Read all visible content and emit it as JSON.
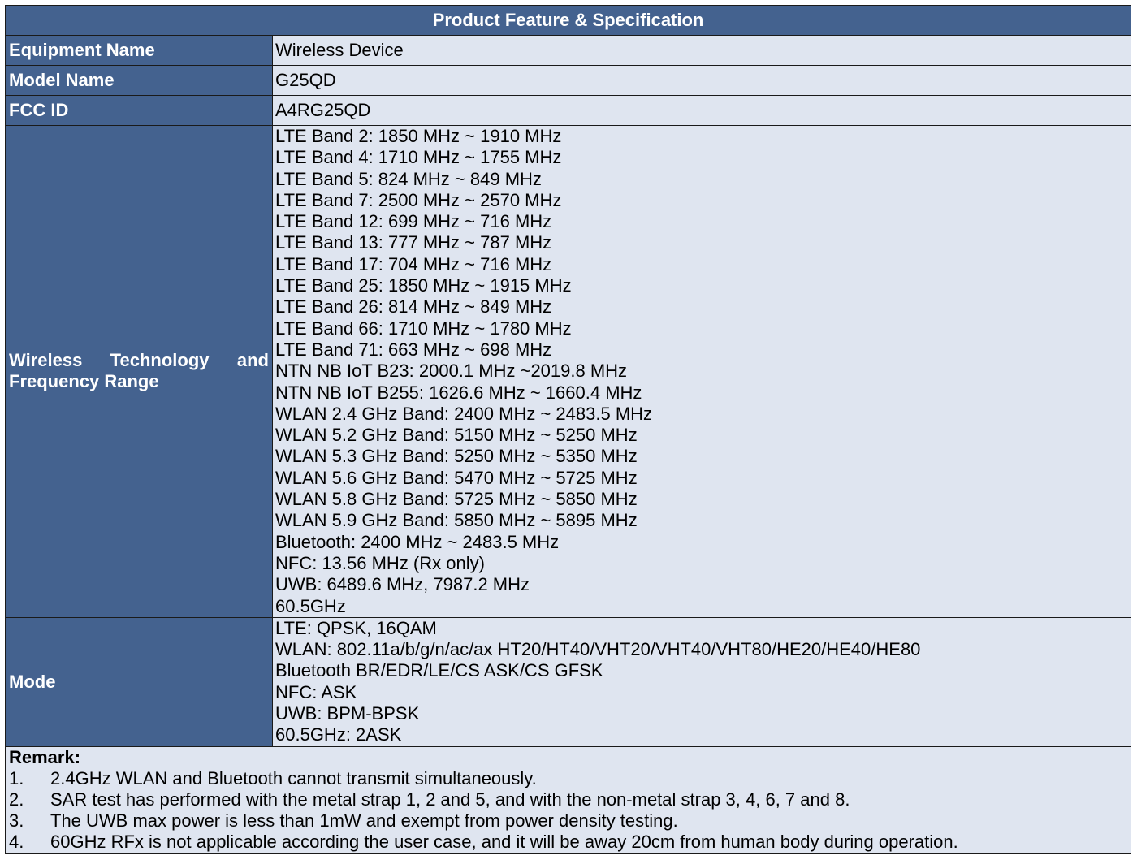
{
  "title": "Product Feature & Specification",
  "rows": {
    "equipment": {
      "label": "Equipment Name",
      "value": "Wireless Device"
    },
    "model": {
      "label": "Model Name",
      "value": "G25QD"
    },
    "fcc": {
      "label": "FCC ID",
      "value": "A4RG25QD"
    }
  },
  "wireless": {
    "label": "Wireless Technology and Frequency Range",
    "lines": [
      "LTE Band 2: 1850 MHz ~ 1910 MHz",
      "LTE Band 4: 1710 MHz ~ 1755 MHz",
      "LTE Band 5: 824 MHz ~ 849 MHz",
      "LTE Band 7: 2500 MHz ~ 2570 MHz",
      "LTE Band 12: 699 MHz ~ 716 MHz",
      "LTE Band 13: 777 MHz ~ 787 MHz",
      "LTE Band 17: 704 MHz ~ 716 MHz",
      "LTE Band 25: 1850 MHz ~ 1915 MHz",
      "LTE Band 26: 814 MHz ~ 849 MHz",
      "LTE Band 66: 1710 MHz ~ 1780 MHz",
      "LTE Band 71: 663 MHz ~ 698 MHz",
      "NTN NB IoT B23: 2000.1 MHz ~2019.8 MHz",
      "NTN NB IoT B255: 1626.6 MHz ~ 1660.4 MHz",
      "WLAN 2.4 GHz Band: 2400 MHz ~ 2483.5 MHz",
      "WLAN 5.2 GHz Band: 5150 MHz ~ 5250 MHz",
      "WLAN 5.3 GHz Band: 5250 MHz ~ 5350 MHz",
      "WLAN 5.6 GHz Band: 5470 MHz ~ 5725 MHz",
      "WLAN 5.8 GHz Band: 5725 MHz ~ 5850 MHz",
      "WLAN 5.9 GHz Band: 5850 MHz ~ 5895 MHz",
      "Bluetooth: 2400 MHz ~ 2483.5 MHz",
      "NFC: 13.56 MHz (Rx only)",
      "UWB: 6489.6 MHz, 7987.2 MHz",
      "60.5GHz"
    ]
  },
  "mode": {
    "label": "Mode",
    "lines": [
      "LTE: QPSK, 16QAM",
      "WLAN: 802.11a/b/g/n/ac/ax HT20/HT40/VHT20/VHT40/VHT80/HE20/HE40/HE80",
      "Bluetooth BR/EDR/LE/CS ASK/CS GFSK",
      "NFC: ASK",
      "UWB: BPM-BPSK",
      "60.5GHz: 2ASK"
    ]
  },
  "remark": {
    "heading": "Remark:",
    "items": [
      {
        "num": "1.",
        "text": "2.4GHz WLAN and Bluetooth cannot transmit simultaneously."
      },
      {
        "num": "2.",
        "text": "SAR test has performed with the metal strap 1, 2 and 5, and with the non-metal strap 3, 4, 6, 7 and 8."
      },
      {
        "num": "3.",
        "text": "The UWB max power is less than 1mW and exempt from power density testing."
      },
      {
        "num": "4.",
        "text": "60GHz RFx is not applicable according the user case, and it will be away 20cm from human body during operation."
      }
    ]
  },
  "colors": {
    "header_bg": "#44628f",
    "value_bg": "#dfe5f0",
    "border": "#1a1a1a"
  }
}
